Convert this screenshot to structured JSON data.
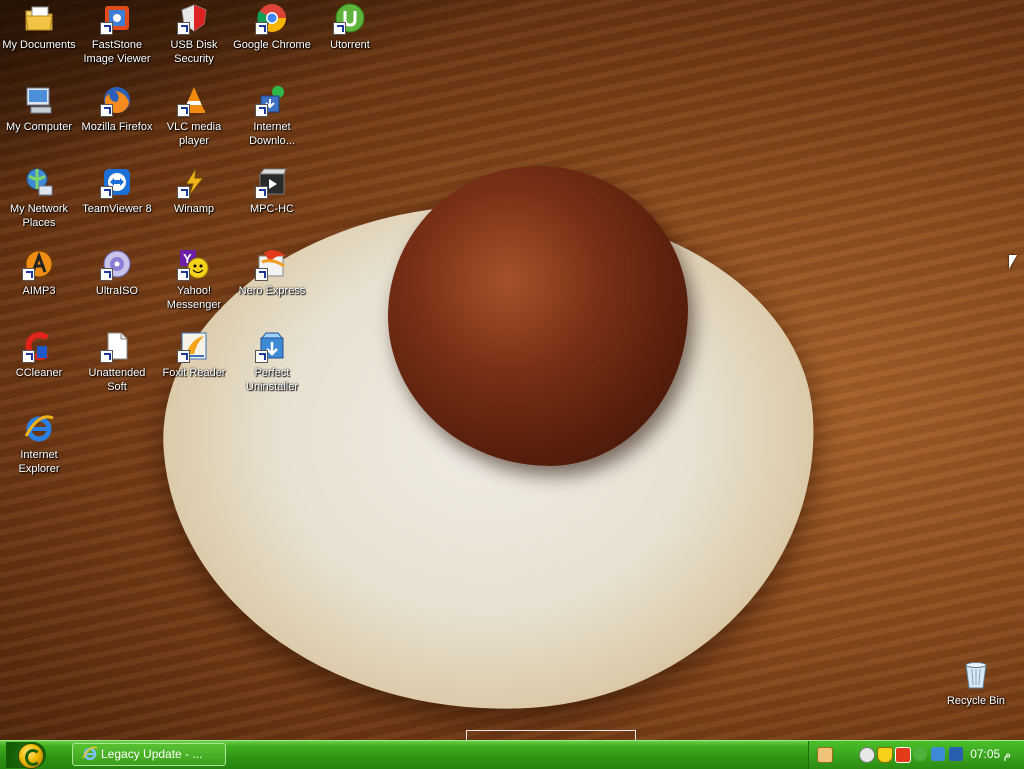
{
  "desktop": {
    "icons": [
      {
        "label": "My Documents",
        "icon": "folder-documents-icon"
      },
      {
        "label": "FastStone Image Viewer",
        "icon": "faststone-icon"
      },
      {
        "label": "USB Disk Security",
        "icon": "usb-security-icon"
      },
      {
        "label": "Google Chrome",
        "icon": "chrome-icon"
      },
      {
        "label": "Utorrent",
        "icon": "utorrent-icon"
      },
      {
        "label": "My Computer",
        "icon": "computer-icon"
      },
      {
        "label": "Mozilla Firefox",
        "icon": "firefox-icon"
      },
      {
        "label": "VLC media player",
        "icon": "vlc-icon"
      },
      {
        "label": "Internet Downlo...",
        "icon": "idm-icon"
      },
      {
        "label": "My Network Places",
        "icon": "network-icon"
      },
      {
        "label": "TeamViewer 8",
        "icon": "teamviewer-icon"
      },
      {
        "label": "Winamp",
        "icon": "winamp-icon"
      },
      {
        "label": "MPC-HC",
        "icon": "mpc-hc-icon"
      },
      {
        "label": "AIMP3",
        "icon": "aimp-icon"
      },
      {
        "label": "UltraISO",
        "icon": "ultraiso-icon"
      },
      {
        "label": "Yahoo! Messenger",
        "icon": "yahoo-messenger-icon"
      },
      {
        "label": "Nero Express",
        "icon": "nero-icon"
      },
      {
        "label": "CCleaner",
        "icon": "ccleaner-icon"
      },
      {
        "label": "Unattended Soft",
        "icon": "file-icon"
      },
      {
        "label": "Foxit Reader",
        "icon": "foxit-icon"
      },
      {
        "label": "Perfect Uninstaller",
        "icon": "uninstaller-icon"
      },
      {
        "label": "Internet Explorer",
        "icon": "ie-icon"
      },
      {
        "label": "Recycle Bin",
        "icon": "recycle-bin-icon"
      }
    ]
  },
  "taskbar": {
    "start_icon": "start-orb-icon",
    "task_button_label": "Legacy Update - ...",
    "clock": "07:05 م",
    "tray_icons": [
      "notes-icon",
      "messenger-icon",
      "shield-icon",
      "security-icon",
      "utorrent-tray-icon",
      "network-icon",
      "volume-icon"
    ]
  },
  "colors": {
    "taskbar_green": "#2e9414",
    "label_text": "#ffffff"
  }
}
